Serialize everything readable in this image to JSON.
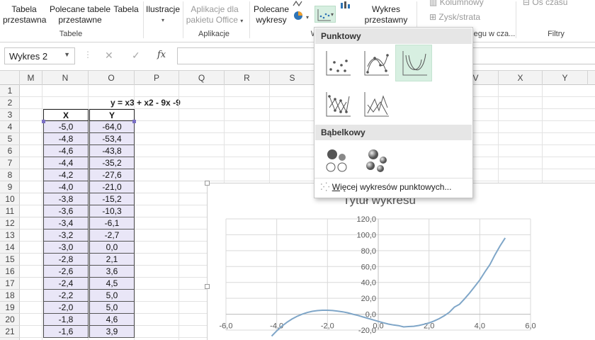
{
  "ribbon": {
    "pivot_table": [
      "Tabela",
      "przestawna"
    ],
    "recommended_pivot": [
      "Polecane tabele",
      "przestawne"
    ],
    "table": "Tabela",
    "group_tables": "Tabele",
    "illustrations": "Ilustracje",
    "apps": [
      "Aplikacje dla",
      "pakietu Office"
    ],
    "group_apps": "Aplikacje",
    "recommended_charts": [
      "Polecane",
      "wykresy"
    ],
    "group_charts_partial": "W",
    "pivot_chart": [
      "Wykres",
      "przestawny"
    ],
    "sparkline_column": "Kolumnowy",
    "sparkline_winloss": "Zysk/strata",
    "sparkline_group_partial": "egu w cza...",
    "timeline": "Oś czasu",
    "group_filters": "Filtry"
  },
  "formula_bar": {
    "name_box": "Wykres 2",
    "cancel_symbol": "✕",
    "enter_symbol": "✓",
    "fx_symbol": "fx"
  },
  "columns": [
    "M",
    "N",
    "O",
    "P",
    "Q",
    "R",
    "S",
    "V",
    "X",
    "Y"
  ],
  "rows": [
    "1",
    "2",
    "3",
    "4",
    "5",
    "6",
    "7",
    "8",
    "9",
    "10",
    "11",
    "12",
    "13",
    "14",
    "15",
    "16",
    "17",
    "18",
    "19",
    "20",
    "21"
  ],
  "sheet": {
    "formula_label": "y = x3 + x2 - 9x -9",
    "header_x": "X",
    "header_y": "Y",
    "x_values": [
      "-5,0",
      "-4,8",
      "-4,6",
      "-4,4",
      "-4,2",
      "-4,0",
      "-3,8",
      "-3,6",
      "-3,4",
      "-3,2",
      "-3,0",
      "-2,8",
      "-2,6",
      "-2,4",
      "-2,2",
      "-2,0",
      "-1,8",
      "-1,6"
    ],
    "y_values": [
      "-64,0",
      "-53,4",
      "-43,8",
      "-35,2",
      "-27,6",
      "-21,0",
      "-15,2",
      "-10,3",
      "-6,1",
      "-2,7",
      "0,0",
      "2,1",
      "3,6",
      "4,5",
      "5,0",
      "5,0",
      "4,6",
      "3,9"
    ]
  },
  "dropdown": {
    "section_scatter": "Punktowy",
    "section_bubble": "Bąbelkowy",
    "more_prefix": "W",
    "more_rest": "ięcej wykresów punktowych..."
  },
  "chart_data": {
    "type": "scatter",
    "title": "Tytuł wykresu",
    "x_ticks": [
      "-6,0",
      "-4,0",
      "-2,0",
      "0,0",
      "2,0",
      "4,0",
      "6,0"
    ],
    "y_ticks": [
      "120,0",
      "100,0",
      "80,0",
      "60,0",
      "40,0",
      "20,0",
      "0,0",
      "-20,0"
    ],
    "xlim": [
      -6,
      6
    ],
    "ylim": [
      -20,
      120
    ],
    "series": [
      {
        "line_color": "#7fa6c8",
        "x": [
          -5,
          -4.8,
          -4.6,
          -4.4,
          -4.2,
          -4,
          -3.8,
          -3.6,
          -3.4,
          -3.2,
          -3,
          -2.8,
          -2.6,
          -2.4,
          -2.2,
          -2,
          -1.8,
          -1.6,
          -1.4,
          -1.2,
          -1,
          -0.8,
          -0.6,
          -0.4,
          -0.2,
          0,
          0.2,
          0.4,
          0.6,
          0.8,
          1,
          1.2,
          1.4,
          1.6,
          1.8,
          2,
          2.2,
          2.4,
          2.6,
          2.8,
          3,
          3.2,
          3.4,
          3.6,
          3.8,
          4,
          4.2,
          4.4,
          4.6,
          4.8,
          5
        ],
        "y": [
          -64,
          -53.4,
          -43.8,
          -35.2,
          -27.6,
          -21,
          -15.2,
          -10.3,
          -6.1,
          -2.7,
          0,
          2.1,
          3.6,
          4.5,
          5,
          5,
          4.6,
          3.9,
          3,
          1.8,
          0,
          -1.5,
          -3.5,
          -5.3,
          -7.2,
          -9,
          -10.8,
          -12.4,
          -13.6,
          -14.4,
          -16,
          -15.5,
          -15.2,
          -14.2,
          -12.7,
          -11,
          -8.6,
          -5.6,
          -2.0,
          2.4,
          9,
          12.5,
          19.3,
          26.7,
          34.8,
          43,
          53.1,
          62.6,
          74.8,
          86.0,
          96
        ]
      }
    ]
  }
}
